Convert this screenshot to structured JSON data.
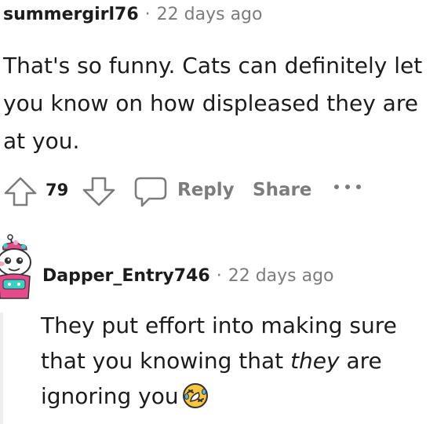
{
  "comment1": {
    "author": "summergirl76",
    "separator": "·",
    "time": "22 days ago",
    "body": "That's so funny. Cats can definitely let you know on how displeased they are at you."
  },
  "actions": {
    "score": "79",
    "reply_label": "Reply",
    "share_label": "Share",
    "upvote_icon": "upvote-arrow-icon",
    "downvote_icon": "downvote-arrow-icon",
    "reply_icon": "speech-bubble-icon",
    "more_icon": "ellipsis-icon"
  },
  "comment2": {
    "author": "Dapper_Entry746",
    "separator": "·",
    "time": "22 days ago",
    "body_part1": "They put effort into making sure that you knowing that ",
    "body_emphasis": "they",
    "body_part2": " are ignoring you",
    "emoji": "rolling-on-floor-laughing-emoji",
    "avatar": "snoo-avatar-icon"
  },
  "colors": {
    "text": "#1c1c1c",
    "muted": "#7c7c7c",
    "thread_line": "#edeff1",
    "emoji_fill": "#f7c540"
  }
}
